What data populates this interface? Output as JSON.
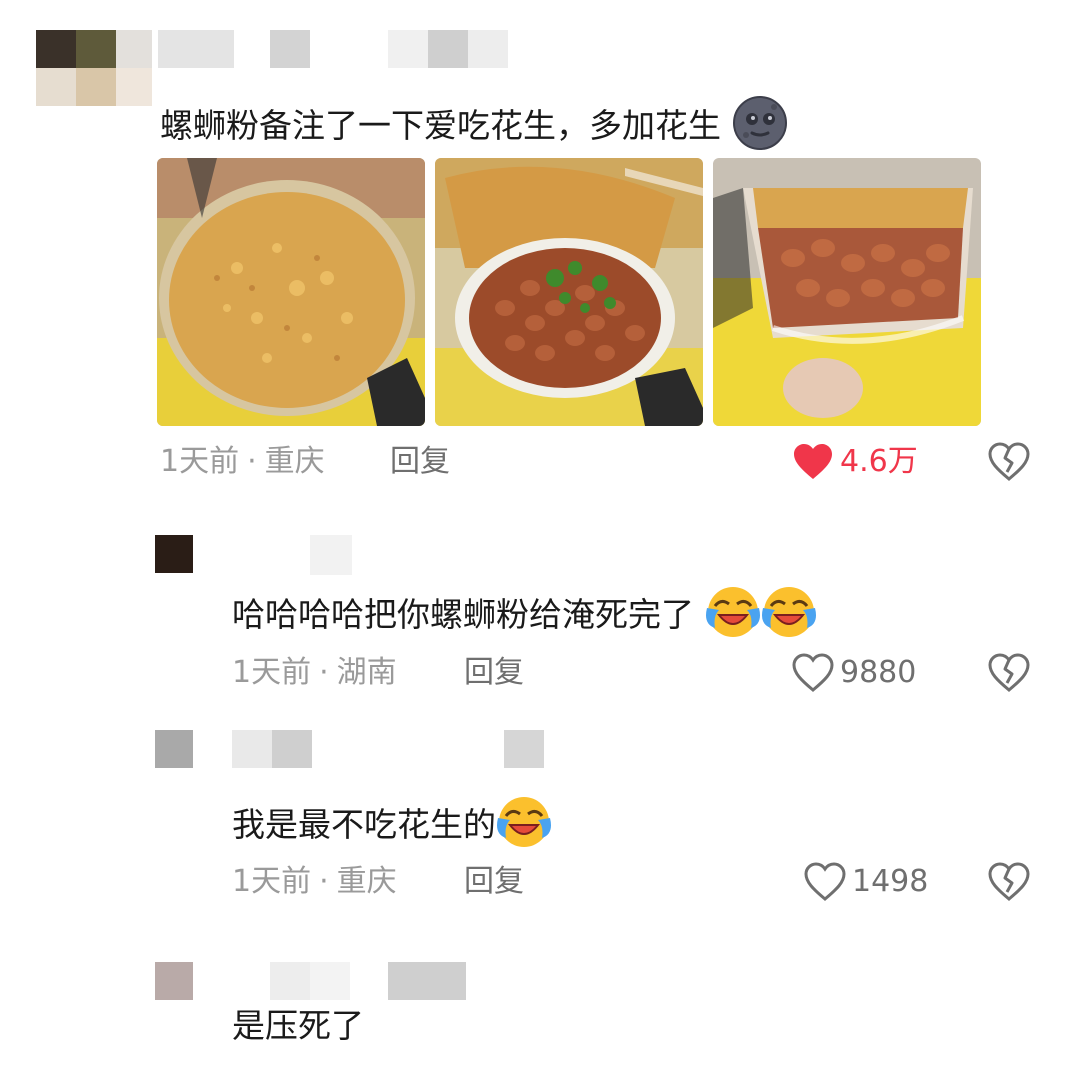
{
  "comments": [
    {
      "text": "螺蛳粉备注了一下爱吃花生，多加花生",
      "emoji": "moon-face-emoji",
      "time": "1天前",
      "location": "重庆",
      "reply_label": "回复",
      "likes": "4.6万",
      "liked": true
    },
    {
      "text": "哈哈哈哈把你螺蛳粉给淹死完了",
      "emoji": "crying-laughing-emoji",
      "time": "1天前",
      "location": "湖南",
      "reply_label": "回复",
      "likes": "9880",
      "liked": false
    },
    {
      "text": "我是最不吃花生的",
      "emoji": "crying-laughing-emoji",
      "time": "1天前",
      "location": "重庆",
      "reply_label": "回复",
      "likes": "1498",
      "liked": false
    },
    {
      "text": "是压死了"
    }
  ],
  "colors": {
    "like_active": "#f0364a",
    "meta_gray": "#9a9a9a",
    "icon_gray": "#6f6f6f"
  },
  "icons": [
    "heart-icon",
    "broken-heart-icon",
    "moon-face-emoji",
    "crying-laughing-emoji"
  ]
}
